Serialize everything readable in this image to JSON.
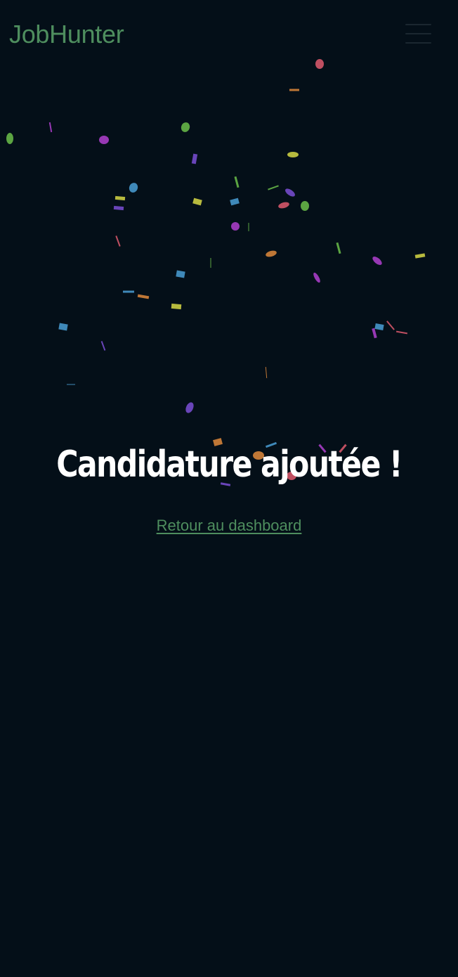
{
  "app": {
    "brand": "JobHunter"
  },
  "header": {
    "menu_icon": "hamburger-menu-icon"
  },
  "main": {
    "title": "Candidature ajoutée !",
    "back_link": "Retour au dashboard"
  },
  "colors": {
    "background": "#040f18",
    "brand": "#4e8e5e",
    "title": "#ffffff",
    "link": "#4e8e5e",
    "confetti": [
      "#e05a6e",
      "#e08a3c",
      "#6cc04a",
      "#b23fd0",
      "#4a9fd6",
      "#d7d845",
      "#7b4fd6"
    ]
  }
}
